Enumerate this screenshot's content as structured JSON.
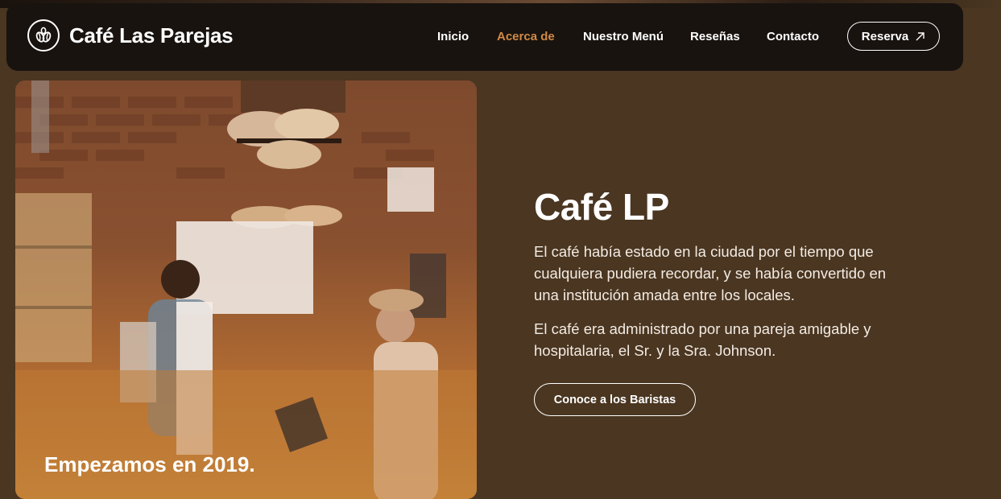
{
  "brand": {
    "name": "Café Las Parejas",
    "logo_icon": "coffee-beans-icon"
  },
  "nav": {
    "items": [
      {
        "label": "Inicio",
        "active": false
      },
      {
        "label": "Acerca de",
        "active": true
      },
      {
        "label": "Nuestro Menú",
        "active": false
      },
      {
        "label": "Reseñas",
        "active": false
      },
      {
        "label": "Contacto",
        "active": false
      }
    ],
    "cta_label": "Reserva",
    "cta_icon": "arrow-up-right-icon"
  },
  "about": {
    "image_caption": "Empezamos en 2019.",
    "title": "Café LP",
    "paragraphs": [
      "El café había estado en la ciudad por el tiempo que cualquiera pudiera recordar, y se había convertido en una institución amada entre los locales.",
      "El café era administrado por una pareja amigable y hospitalaria, el Sr. y la Sra. Johnson."
    ],
    "button_label": "Conoce a los Baristas"
  },
  "colors": {
    "background": "#4a3621",
    "navbar": "#18130f",
    "accent": "#d08a45",
    "text": "#ffffff"
  }
}
